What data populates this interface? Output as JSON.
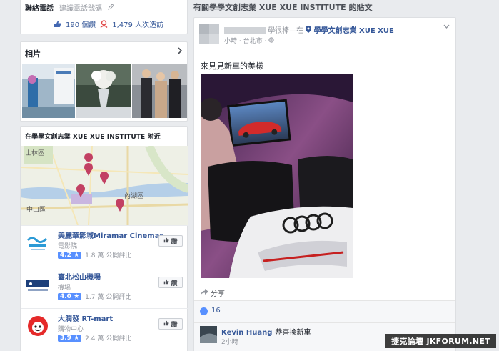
{
  "info": {
    "contact_label": "聯絡電話",
    "contact_hint": "建議電話號碼",
    "likes": "190 個讚",
    "checkins": "1,479 人次造訪"
  },
  "photos": {
    "title": "相片"
  },
  "nearby": {
    "title": "在學學文創志業 XUE XUE INSTITUTE 附近",
    "map_labels": [
      "士林區",
      "內湖區",
      "中山區"
    ],
    "places": [
      {
        "name": "美麗華影城Miramar Cinemas",
        "category": "電影院",
        "rating": "4.2 ★",
        "reviews": "1.8 萬 公開評比",
        "like_label": "讚"
      },
      {
        "name": "臺北松山機場",
        "category": "機場",
        "rating": "4.0 ★",
        "reviews": "1.7 萬 公開評比",
        "like_label": "讚"
      },
      {
        "name": "大潤發 RT-mart",
        "category": "購物中心",
        "rating": "3.9 ★",
        "reviews": "2.4 萬 公開評比",
        "like_label": "讚"
      }
    ]
  },
  "posts": {
    "header": "有關學學文創志業 XUE XUE INSTITUTE 的貼文",
    "post": {
      "author_suffix": "學很棒—在",
      "page_name": "學學文創志業 XUE XUE",
      "meta": "小時 · 台北市 · ",
      "text": "來見見新車的美樣",
      "share_label": "分享",
      "like_count": "16",
      "comment_author": "Kevin Huang",
      "comment_text": "恭喜換新車",
      "comment_time": "2小時"
    }
  },
  "watermark": "捷克論壇 JKFORUM.NET",
  "colors": {
    "link": "#365899",
    "accent": "#5890ff",
    "background": "#e9ebee"
  }
}
